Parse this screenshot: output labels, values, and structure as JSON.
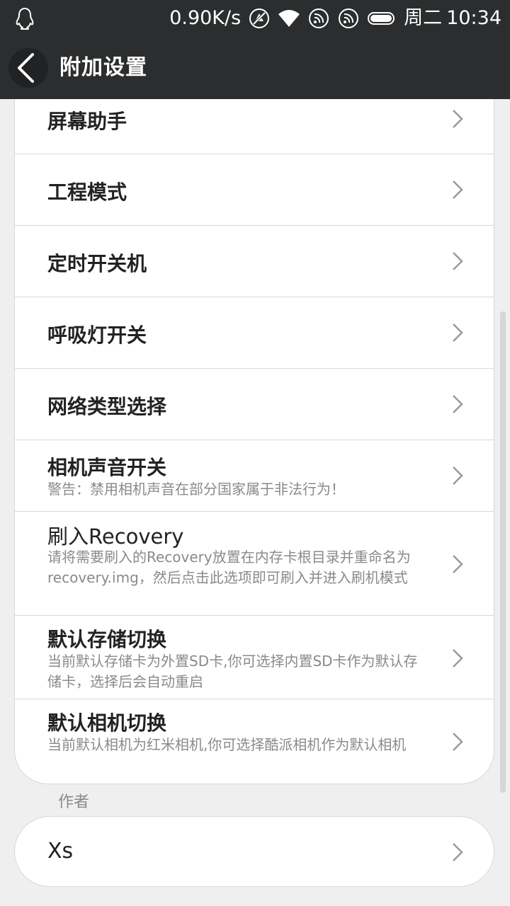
{
  "status_bar": {
    "network_speed": "0.90K/s",
    "day": "周二",
    "time": "10:34",
    "icons": [
      "qq-penguin-icon",
      "alarm-off-icon",
      "wifi-icon",
      "nfc-icon",
      "nfc-icon",
      "battery-icon"
    ]
  },
  "header": {
    "title": "附加设置",
    "back_icon": "back-arrow-icon"
  },
  "settings": {
    "items": [
      {
        "title": "屏幕助手",
        "subtitle": ""
      },
      {
        "title": "工程模式",
        "subtitle": ""
      },
      {
        "title": "定时开关机",
        "subtitle": ""
      },
      {
        "title": "呼吸灯开关",
        "subtitle": ""
      },
      {
        "title": "网络类型选择",
        "subtitle": ""
      },
      {
        "title": "相机声音开关",
        "subtitle": "警告：禁用相机声音在部分国家属于非法行为！"
      },
      {
        "title": "刷入Recovery",
        "subtitle": "请将需要刷入的Recovery放置在内存卡根目录并重命名为recovery.img，然后点击此选项即可刷入并进入刷机模式"
      },
      {
        "title": "默认存储切换",
        "subtitle": "当前默认存储卡为外置SD卡,你可选择内置SD卡作为默认存储卡，选择后会自动重启"
      },
      {
        "title": "默认相机切换",
        "subtitle": "当前默认相机为红米相机,你可选择酷派相机作为默认相机"
      }
    ]
  },
  "author_section": {
    "label": "作者",
    "name": "Xs"
  },
  "colors": {
    "toolbar": "#2b2d2e",
    "background": "#efefef",
    "card": "#ffffff",
    "title_text": "#222222",
    "subtitle_text": "#8a8a8a"
  }
}
